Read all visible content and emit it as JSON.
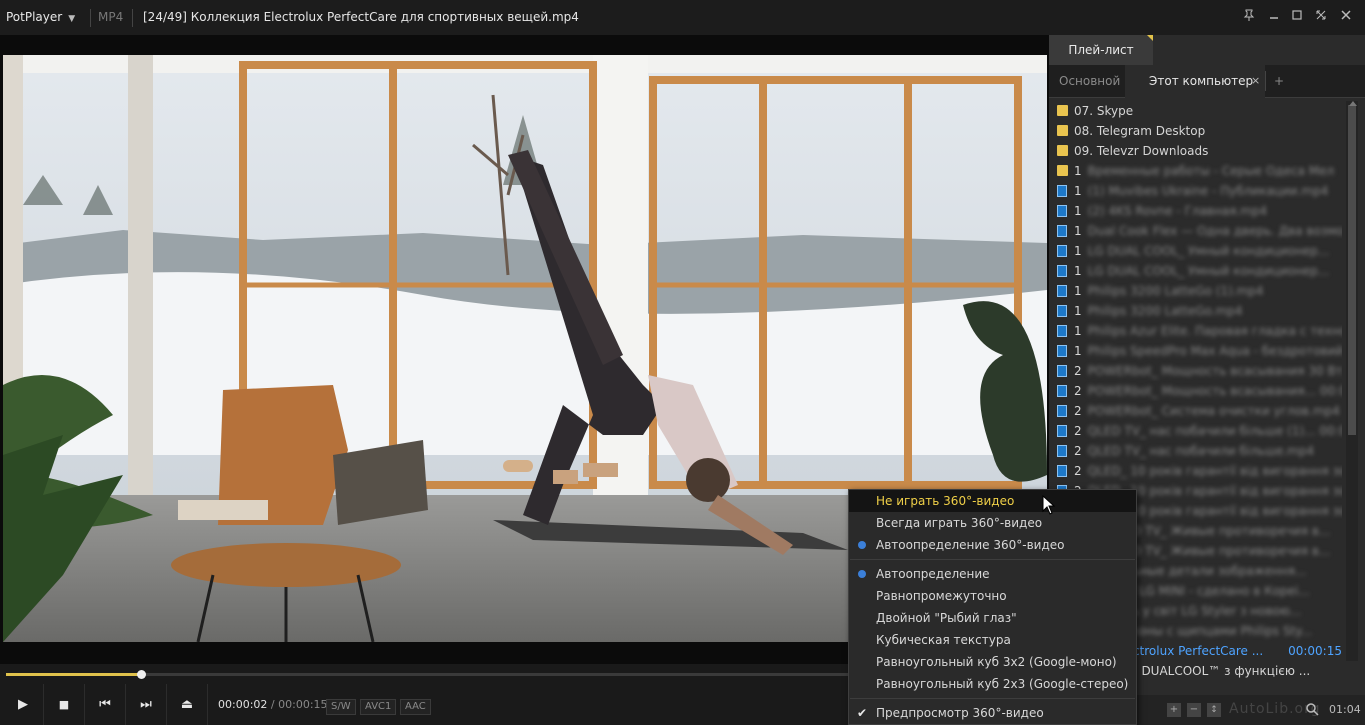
{
  "titlebar": {
    "app_name": "PotPlayer",
    "format": "MP4",
    "title": "[24/49] Коллекция Electrolux PerfectCare для спортивных вещей.mp4"
  },
  "playlist": {
    "tab_label": "Плей-лист",
    "subtab_main": "Основной",
    "subtab_computer": "Этот компьютер",
    "subtab_close": "×",
    "subtab_add": "+",
    "items": [
      {
        "type": "folder",
        "label": "07. Skype"
      },
      {
        "type": "folder",
        "label": "08. Telegram Desktop"
      },
      {
        "type": "folder",
        "label": "09. Televzr Downloads"
      },
      {
        "type": "folder",
        "label": "1",
        "blur": "Временные работы - Серые Одеса Мел"
      },
      {
        "type": "file",
        "label": "1",
        "blur": "(1) Muvibes Ukraine - Публикации.mp4"
      },
      {
        "type": "file",
        "label": "1",
        "blur": "(2) 4KS Rovne - Главная.mp4"
      },
      {
        "type": "file",
        "label": "1",
        "blur": "Dual Cook Flex — Одна дверь. Два возможн..."
      },
      {
        "type": "file",
        "label": "1",
        "blur": "LG DUAL COOL_ Умный кондиционер..."
      },
      {
        "type": "file",
        "label": "1",
        "blur": "LG DUAL COOL_ Умный кондиционер..."
      },
      {
        "type": "file",
        "label": "1",
        "blur": "Philips 3200 LatteGo (1).mp4"
      },
      {
        "type": "file",
        "label": "1",
        "blur": "Philips 3200 LatteGo.mp4"
      },
      {
        "type": "file",
        "label": "1",
        "blur": "Philips Azur Elite. Паровая гладка с технолог..."
      },
      {
        "type": "file",
        "label": "1",
        "blur": "Philips SpeedPro Max Aqua - бездротовий..."
      },
      {
        "type": "file",
        "label": "2",
        "blur": "POWERbot_ Мощность всасывания 30 Вт..."
      },
      {
        "type": "file",
        "label": "2",
        "blur": "POWERbot_ Мощность всасывания... 00:00:19"
      },
      {
        "type": "file",
        "label": "2",
        "blur": "POWERbot_ Система очистки углов.mp4"
      },
      {
        "type": "file",
        "label": "2",
        "blur": "QLED TV_ нас побачили більше (1)... 00:00:20"
      },
      {
        "type": "file",
        "label": "2",
        "blur": "QLED TV_ нас побачили більше.mp4"
      },
      {
        "type": "file",
        "label": "2",
        "blur": "QLED_ 10 років гарантії від вигорання зобра..."
      },
      {
        "type": "file",
        "label": "2",
        "blur": "QLED_ 10 років гарантії від вигорання зобра..."
      },
      {
        "type": "file",
        "label": "2",
        "blur": "QLED_ 10 років гарантії від вигорання зобра..."
      },
      {
        "type": "file",
        "label": "2",
        "blur": "Gg QLED TV_ Живые противоречия в..."
      },
      {
        "type": "file",
        "label": "2",
        "blur": "Gg QLED TV_ Живые противоречия в..."
      },
      {
        "type": "file",
        "label": "2",
        "blur": "Уникальные детали зображення..."
      },
      {
        "type": "file",
        "label": "2",
        "blur": "Функції LG MINI - сделано в Кореі..."
      },
      {
        "type": "file",
        "label": "2",
        "blur": "Увійдіть у світ LG Styler з новою..."
      },
      {
        "type": "file",
        "label": "2",
        "blur": "ные локоны с щипцами Philips Sty...",
        "tail": "ные локоны с щипцами Philips Sty..."
      },
      {
        "type": "file",
        "label": "2",
        "active": true,
        "text": "ция Electrolux PerfectCare ...",
        "time": "00:00:15"
      },
      {
        "type": "file",
        "label": "2",
        "text": "онер LG DUALCOOL™ з функцією ..."
      }
    ],
    "bottom_time": "01:04"
  },
  "controls": {
    "play_icon": "▶",
    "stop_icon": "■",
    "prev_icon": "⏮",
    "next_icon": "⏭",
    "eject_icon": "⏏",
    "time_current": "00:00:02",
    "time_sep": "/",
    "time_total": "00:00:15",
    "badge_sw": "S/W",
    "badge_video": "AVC1",
    "badge_audio": "AAC",
    "progress_fraction": 0.13
  },
  "context_menu": {
    "items": [
      {
        "label": "Не играть 360°-видео",
        "highlighted": true
      },
      {
        "label": "Всегда играть 360°-видео"
      },
      {
        "label": "Автоопределение 360°-видео",
        "radio": true
      },
      {
        "separator": true
      },
      {
        "label": "Автоопределение",
        "radio": true
      },
      {
        "label": "Равнопромежуточно"
      },
      {
        "label": "Двойной \"Рыбий глаз\""
      },
      {
        "label": "Кубическая текстура"
      },
      {
        "label": "Равноугольный куб 3x2 (Google-моно)"
      },
      {
        "label": "Равноугольный куб 2x3 (Google-стерео)"
      },
      {
        "separator": true
      },
      {
        "label": "Предпросмотр 360°-видео",
        "check": true
      }
    ]
  },
  "watermark": "AutoLib.org",
  "colors": {
    "accent": "#e0c24c",
    "active_item": "#4ea3ff",
    "radio": "#3b7fd8"
  }
}
